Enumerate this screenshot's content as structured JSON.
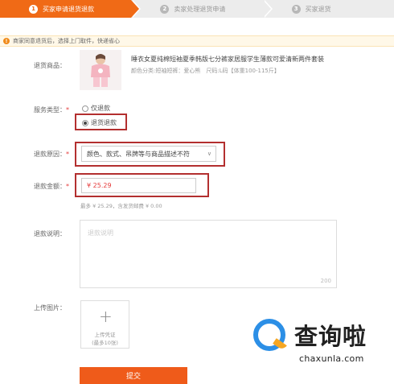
{
  "steps": [
    {
      "num": "1",
      "label": "买家申请退货退款"
    },
    {
      "num": "2",
      "label": "卖家处理退货申请"
    },
    {
      "num": "3",
      "label": "买家退货"
    }
  ],
  "notice": "商家同意退货后，选择上门取件，快递省心",
  "form": {
    "product_label": "退货商品：",
    "product_title": "睡衣女夏纯棉短袖夏季韩版七分裤家居服学生薄款可爱清新两件套装",
    "product_attr": "颜色分类:短袖短裤：爱心熊　尺码:L码【体重100-115斤】",
    "service_label": "服务类型：",
    "service_options": [
      "仅退款",
      "退货退款"
    ],
    "service_selected": "退货退款",
    "reason_label": "退款原因：",
    "reason_value": "颜色、款式、吊牌等与商品描述不符",
    "amount_label": "退款金额：",
    "amount_value": "¥ 25.29",
    "amount_hint": "最多 ¥ 25.29，含发货邮费 ¥ 0.00",
    "desc_label": "退款说明：",
    "desc_placeholder": "退款说明",
    "desc_counter": "200",
    "upload_label": "上传图片：",
    "upload_text": "上传凭证",
    "upload_limit": "(最多10张)",
    "submit_label": "提交",
    "required_mark": "*"
  },
  "watermark": {
    "brand": "查询啦",
    "domain": "chaxunla.com"
  },
  "colors": {
    "accent": "#f06a16",
    "highlight_box": "#b32f2f",
    "price": "#e53c3c",
    "watermark_blue": "#2c8fe6",
    "watermark_orange": "#f5a623"
  }
}
